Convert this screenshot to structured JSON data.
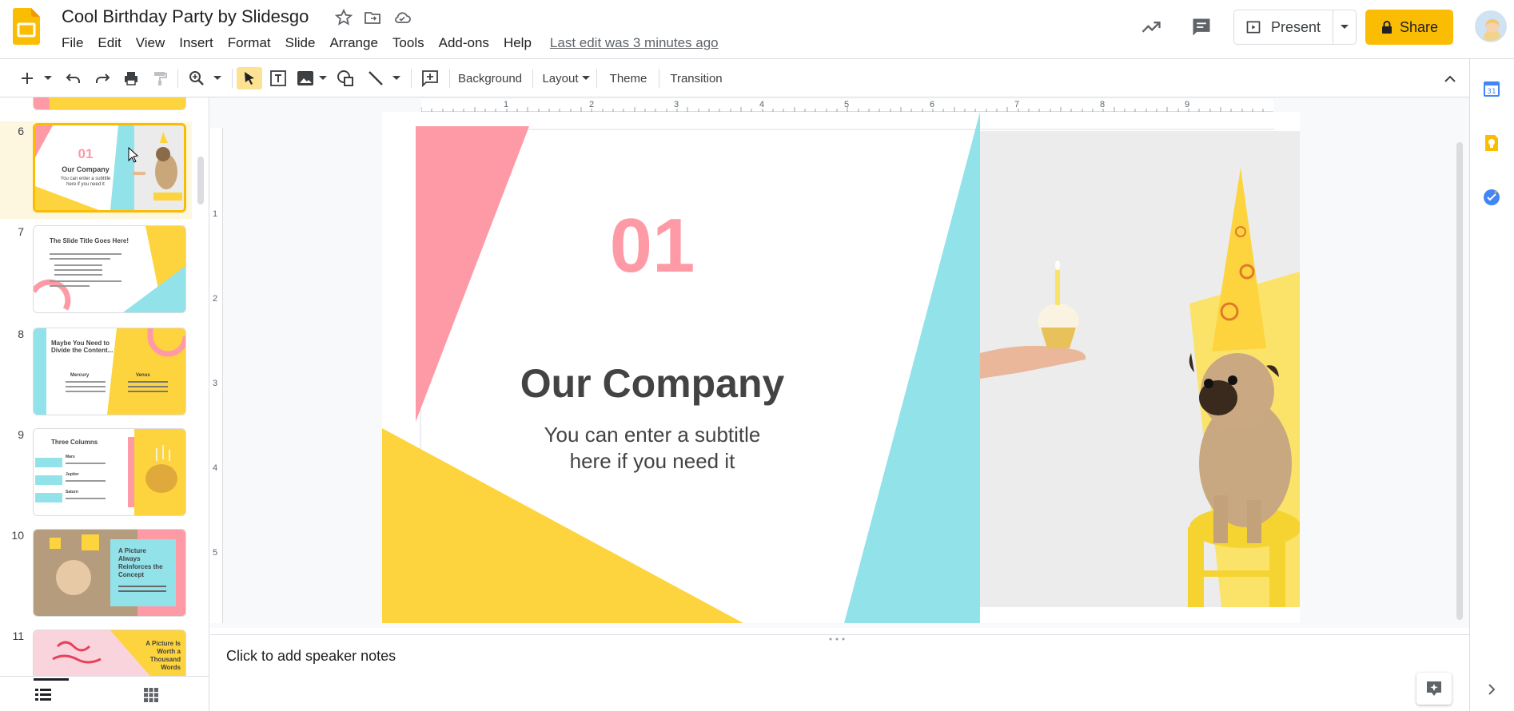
{
  "header": {
    "title": "Cool Birthday Party by Slidesgo",
    "menus": [
      "File",
      "Edit",
      "View",
      "Insert",
      "Format",
      "Slide",
      "Arrange",
      "Tools",
      "Add-ons",
      "Help"
    ],
    "last_edit": "Last edit was 3 minutes ago",
    "present_label": "Present",
    "share_label": "Share"
  },
  "toolbar": {
    "background_label": "Background",
    "layout_label": "Layout",
    "theme_label": "Theme",
    "transition_label": "Transition"
  },
  "filmstrip": {
    "slides": [
      {
        "number": "6",
        "line1": "01",
        "line2": "Our Company",
        "line3": "You can enter a subtitle here if you need it"
      },
      {
        "number": "7",
        "line1": "The Slide Title Goes Here!"
      },
      {
        "number": "8",
        "line1": "Maybe You Need to Divide the Content...",
        "col1": "Mercury",
        "col2": "Venus"
      },
      {
        "number": "9",
        "line1": "Three Columns",
        "col1": "Mars",
        "col2": "Jupiter",
        "col3": "Saturn"
      },
      {
        "number": "10",
        "line1": "A Picture Always Reinforces the Concept"
      },
      {
        "number": "11",
        "line1": "A Picture Is Worth a Thousand Words"
      }
    ]
  },
  "ruler": {
    "h_numbers": [
      "1",
      "2",
      "3",
      "4",
      "5",
      "6",
      "7",
      "8",
      "9"
    ],
    "v_numbers": [
      "1",
      "2",
      "3",
      "4",
      "5"
    ]
  },
  "slide": {
    "number": "01",
    "title": "Our Company",
    "subtitle_line1": "You can enter a subtitle",
    "subtitle_line2": "here if you need it"
  },
  "notes": {
    "placeholder": "Click to add speaker notes"
  },
  "colors": {
    "pink": "#fe9aa6",
    "yellow": "#fdd43d",
    "cyan": "#92e2ea",
    "dark_text": "#434343",
    "share_yellow": "#fbbc04"
  },
  "icons": {
    "app": "slides-logo-icon",
    "star": "star-icon",
    "move": "folder-move-icon",
    "cloud": "cloud-saved-icon"
  }
}
